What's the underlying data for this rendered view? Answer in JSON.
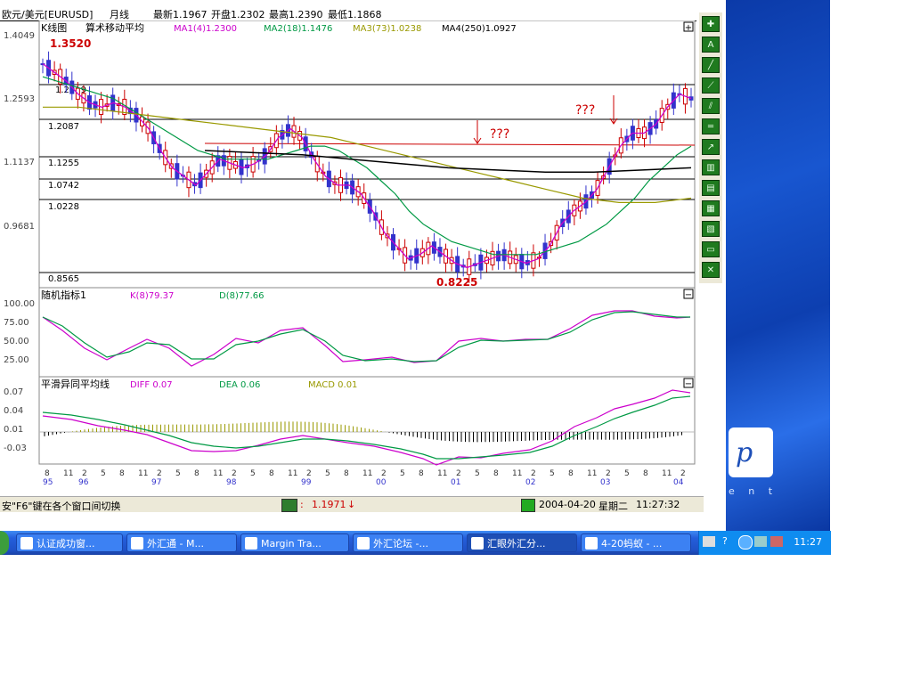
{
  "header": {
    "symbol": "欧元/美元[EURUSD]",
    "period": "月线",
    "latest": "最新1.1967",
    "open": "开盘1.2302",
    "high": "最高1.2390",
    "low": "最低1.1868"
  },
  "panel_ma": {
    "name": "K线图",
    "indicator": "算术移动平均",
    "ma1": "MA1(4)1.2300",
    "ma2": "MA2(18)1.1476",
    "ma3": "MA3(73)1.0238",
    "ma4": "MA4(250)1.0927",
    "high_label": "1.3520",
    "low_label": "0.8225",
    "yticks": [
      "1.4049",
      "1.2593",
      "1.1137",
      "0.9681"
    ],
    "levels": [
      "1.2919",
      "1.2087",
      "1.1255",
      "1.0742",
      "1.0228",
      "0.8565"
    ],
    "annot1": "???",
    "annot2": "???"
  },
  "panel_kd": {
    "name": "随机指标1",
    "k": "K(8)79.37",
    "d": "D(8)77.66",
    "yticks": [
      "100.00",
      "75.00",
      "50.00",
      "25.00"
    ]
  },
  "panel_macd": {
    "name": "平滑异同平均线",
    "diff": "DIFF 0.07",
    "dea": "DEA 0.06",
    "macd": "MACD 0.01",
    "yticks": [
      "0.07",
      "0.04",
      "0.01",
      "-0.03"
    ]
  },
  "xaxis": {
    "labels": [
      "8",
      "11",
      "2",
      "5",
      "8",
      "11",
      "2",
      "5",
      "8",
      "11",
      "2",
      "5",
      "8",
      "11",
      "2",
      "5",
      "8",
      "11",
      "2",
      "5",
      "8",
      "11",
      "2",
      "5",
      "8",
      "11",
      "2",
      "5",
      "8",
      "11",
      "2",
      "5",
      "8",
      "11",
      "2"
    ],
    "years": [
      "95",
      "96",
      "97",
      "98",
      "99",
      "00",
      "01",
      "02",
      "03",
      "04"
    ]
  },
  "status": {
    "hint": "安\"F6\"键在各个窗口间切换",
    "price": "1.1971",
    "date": "2004-04-20",
    "weekday": "星期二",
    "time": "11:27:32"
  },
  "taskbar": {
    "items": [
      {
        "label": "认证成功窗..."
      },
      {
        "label": "外汇通 - M..."
      },
      {
        "label": "Margin Tra..."
      },
      {
        "label": "外汇论坛 -..."
      },
      {
        "label": "汇眼外汇分..."
      },
      {
        "label": "4-20蚂蚁 - ..."
      }
    ],
    "clock": "11:27"
  },
  "colors": {
    "up": "#cc0000",
    "down": "#3333cc",
    "ma1": "#cc00cc",
    "ma2": "#009944",
    "ma3": "#999900",
    "ma4": "#000000",
    "level_red": "#cc0000"
  },
  "chart_data": {
    "type": "candlestick",
    "series": [
      {
        "name": "MA1(4)",
        "values": [
          1.34,
          1.32,
          1.3,
          1.27,
          1.25,
          1.24,
          1.25,
          1.24,
          1.22,
          1.19,
          1.14,
          1.1,
          1.08,
          1.06,
          1.09,
          1.12,
          1.11,
          1.1,
          1.11,
          1.13,
          1.17,
          1.19,
          1.17,
          1.12,
          1.08,
          1.06,
          1.06,
          1.04,
          1.0,
          0.95,
          0.92,
          0.89,
          0.9,
          0.92,
          0.9,
          0.88,
          0.87,
          0.88,
          0.89,
          0.9,
          0.89,
          0.88,
          0.89,
          0.92,
          0.97,
          1.0,
          1.02,
          1.05,
          1.1,
          1.15,
          1.18,
          1.18,
          1.2,
          1.24,
          1.27,
          1.26
        ]
      },
      {
        "name": "MA2(18)",
        "values": [
          1.31,
          1.3,
          1.29,
          1.28,
          1.27,
          1.26,
          1.24,
          1.22,
          1.2,
          1.18,
          1.16,
          1.14,
          1.13,
          1.12,
          1.12,
          1.12,
          1.12,
          1.13,
          1.14,
          1.15,
          1.15,
          1.14,
          1.12,
          1.1,
          1.07,
          1.04,
          1.0,
          0.97,
          0.95,
          0.93,
          0.92,
          0.91,
          0.9,
          0.9,
          0.9,
          0.9,
          0.91,
          0.92,
          0.93,
          0.95,
          0.97,
          1.0,
          1.03,
          1.07,
          1.1,
          1.13,
          1.15
        ]
      },
      {
        "name": "MA3(73)",
        "values": [
          1.24,
          1.24,
          1.23,
          1.22,
          1.21,
          1.2,
          1.19,
          1.18,
          1.17,
          1.15,
          1.13,
          1.11,
          1.09,
          1.07,
          1.05,
          1.03,
          1.02,
          1.02,
          1.03
        ]
      },
      {
        "name": "MA4(250)",
        "values": [
          1.14,
          1.135,
          1.13,
          1.12,
          1.11,
          1.1,
          1.095,
          1.09,
          1.09,
          1.095,
          1.1
        ]
      }
    ]
  }
}
